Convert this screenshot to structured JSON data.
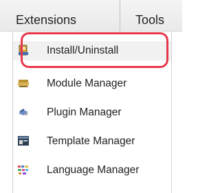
{
  "menubar": {
    "tabs": [
      {
        "label": "Extensions"
      },
      {
        "label": "Tools"
      }
    ]
  },
  "dropdown": {
    "items": [
      {
        "label": "Install/Uninstall",
        "icon": "install-icon"
      },
      {
        "label": "Module Manager",
        "icon": "module-icon"
      },
      {
        "label": "Plugin Manager",
        "icon": "plugin-icon"
      },
      {
        "label": "Template Manager",
        "icon": "template-icon"
      },
      {
        "label": "Language Manager",
        "icon": "language-icon"
      }
    ]
  },
  "colors": {
    "highlight": "#e8354a",
    "menubar": "#eeeeee"
  }
}
